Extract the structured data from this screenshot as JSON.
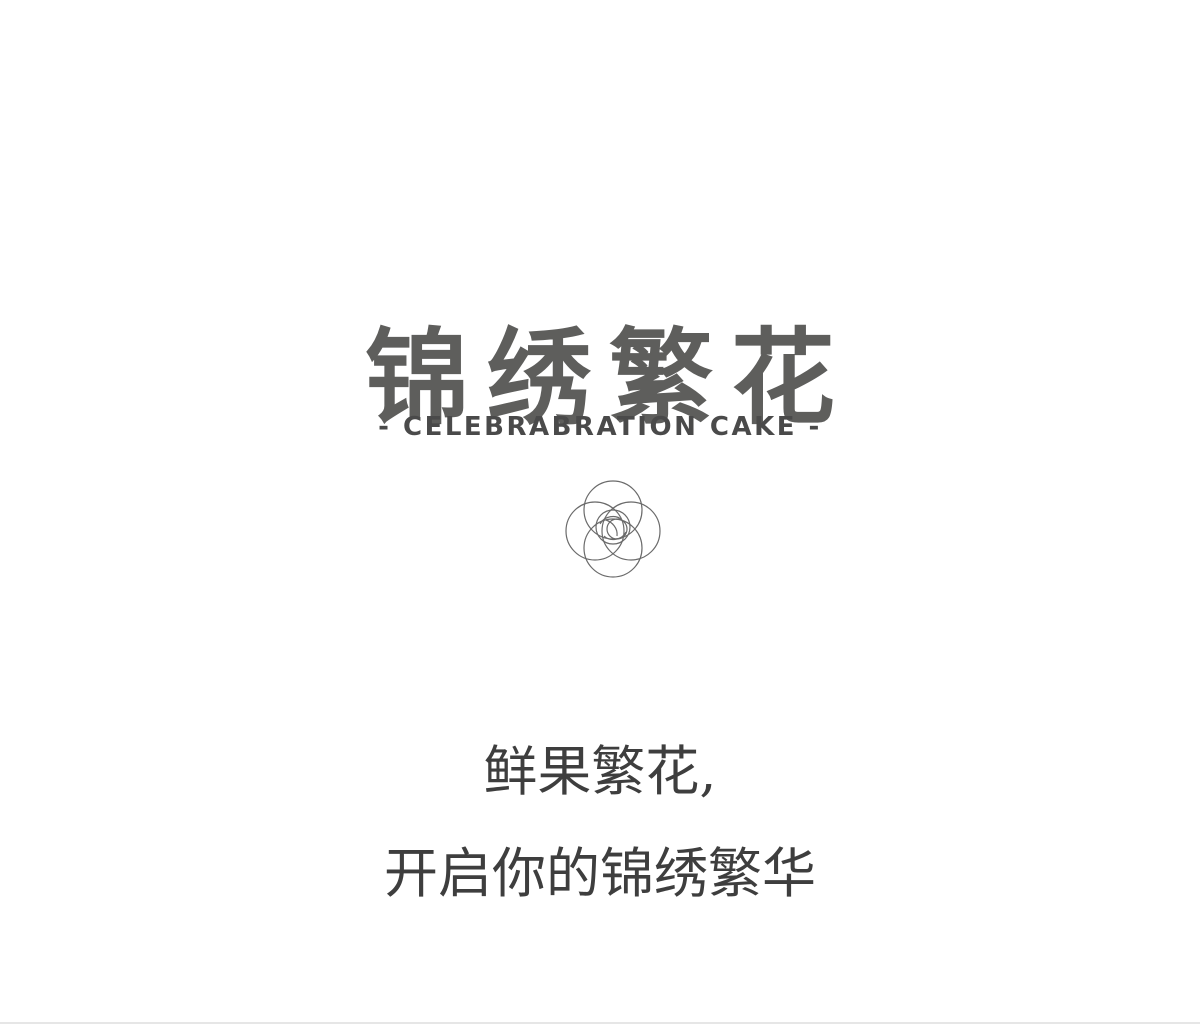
{
  "heading": {
    "title": "锦绣繁花",
    "subtitle": "- CELEBRABRATION CAKE -"
  },
  "emblem": {
    "icon": "flower-knot-icon",
    "stroke_color": "#6a6a6a"
  },
  "tagline": {
    "line1": "鲜果繁花,",
    "line2": "开启你的锦绣繁华"
  },
  "colors": {
    "background": "#ffffff",
    "title": "#5e5e5c",
    "subtitle": "#4a4a4a",
    "tagline": "#3e3e3e"
  }
}
